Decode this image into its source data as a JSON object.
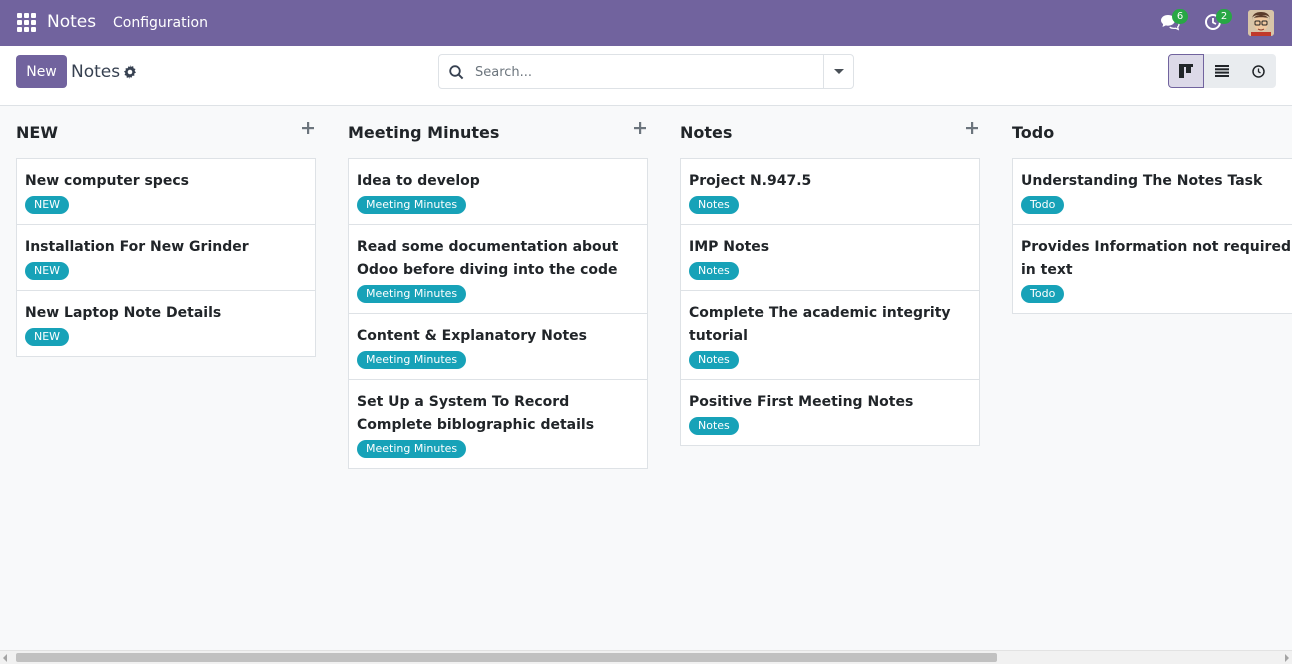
{
  "navbar": {
    "app_name": "Notes",
    "menu_item": "Configuration",
    "messages_count": "6",
    "activities_count": "2",
    "color": "#71639e"
  },
  "control_panel": {
    "new_label": "New",
    "breadcrumb": "Notes",
    "search_placeholder": "Search..."
  },
  "views": [
    "kanban-icon",
    "list-icon",
    "activity-icon"
  ],
  "tag_color": "#17a2b8",
  "columns": [
    {
      "title": "NEW",
      "cards": [
        {
          "title": "New computer specs",
          "tag": "NEW"
        },
        {
          "title": "Installation For New Grinder",
          "tag": "NEW"
        },
        {
          "title": "New Laptop Note Details",
          "tag": "NEW"
        }
      ]
    },
    {
      "title": "Meeting Minutes",
      "cards": [
        {
          "title": "Idea to develop",
          "tag": "Meeting Minutes"
        },
        {
          "title": "Read some documentation about Odoo before diving into the code",
          "tag": "Meeting Minutes"
        },
        {
          "title": "Content & Explanatory Notes",
          "tag": "Meeting Minutes"
        },
        {
          "title": "Set Up a System To Record Complete biblographic details",
          "tag": "Meeting Minutes"
        }
      ]
    },
    {
      "title": "Notes",
      "cards": [
        {
          "title": "Project N.947.5",
          "tag": "Notes"
        },
        {
          "title": "IMP Notes",
          "tag": "Notes"
        },
        {
          "title": "Complete The academic integrity tutorial",
          "tag": "Notes"
        },
        {
          "title": "Positive First Meeting Notes",
          "tag": "Notes"
        }
      ]
    },
    {
      "title": "Todo",
      "cards": [
        {
          "title": "Understanding The Notes Task",
          "tag": "Todo"
        },
        {
          "title": "Provides Information not required in text",
          "tag": "Todo"
        }
      ]
    }
  ]
}
